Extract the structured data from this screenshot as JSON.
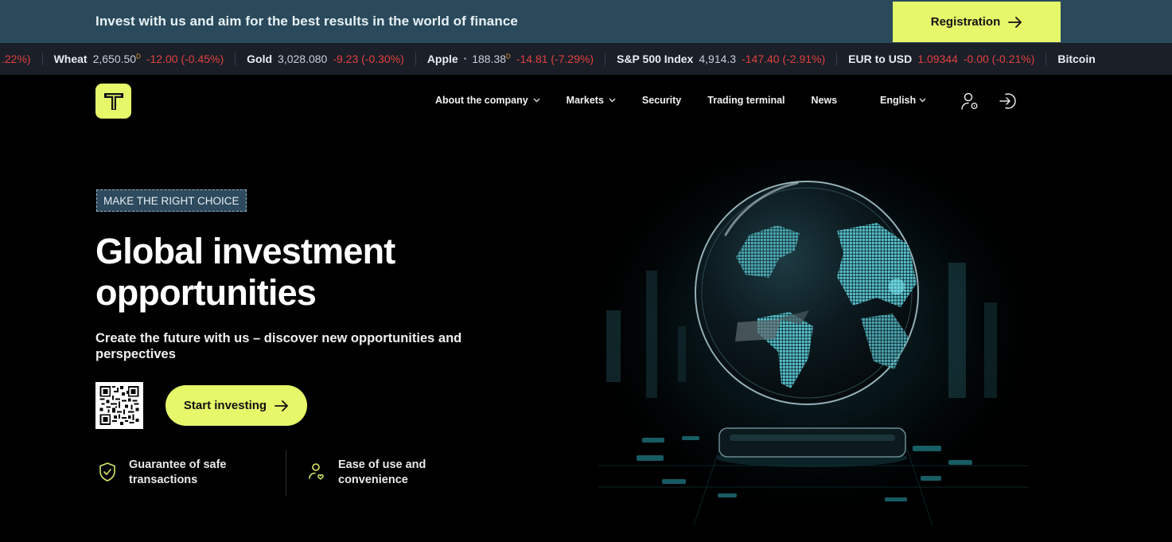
{
  "promo": {
    "text": "Invest with us and aim for the best results in the world of finance",
    "registration_label": "Registration"
  },
  "ticker": [
    {
      "name": "",
      "price": "",
      "change": ".22%)"
    },
    {
      "name": "Wheat",
      "price": "2,650.50",
      "marker": "D",
      "change": "-12.00 (-0.45%)"
    },
    {
      "name": "Gold",
      "price": "3,028.080",
      "marker": "",
      "change": "-9.23 (-0.30%)"
    },
    {
      "name": "Apple",
      "price": "188.38",
      "marker": "D",
      "change": "-14.81 (-7.29%)",
      "dot": "•"
    },
    {
      "name": "S&P 500 Index",
      "price": "4,914.3",
      "marker": "",
      "change": "-147.40 (-2.91%)"
    },
    {
      "name": "EUR to USD",
      "price": "1.09344",
      "marker": "",
      "change": "-0.00 (-0.21%)"
    },
    {
      "name": "Bitcoin",
      "price": "",
      "marker": "",
      "change": ""
    }
  ],
  "nav": {
    "items": [
      {
        "label": "About the company",
        "has_dropdown": true
      },
      {
        "label": "Markets",
        "has_dropdown": true
      },
      {
        "label": "Security",
        "has_dropdown": false
      },
      {
        "label": "Trading terminal",
        "has_dropdown": false
      },
      {
        "label": "News",
        "has_dropdown": false
      }
    ],
    "language": "English",
    "icons": [
      "user-settings-icon",
      "login-icon"
    ]
  },
  "hero": {
    "badge": "MAKE THE RIGHT CHOICE",
    "title_line1": "Global investment",
    "title_line2": "opportunities",
    "subtitle": "Create the future with us – discover new opportunities and perspectives",
    "cta_label": "Start investing"
  },
  "features": [
    {
      "icon": "shield-check-icon",
      "line1": "Guarantee of safe",
      "line2": "transactions"
    },
    {
      "icon": "user-heart-icon",
      "line1": "Ease of use and",
      "line2": "convenience"
    }
  ],
  "colors": {
    "accent": "#e6f76a",
    "promo_bg": "#2a4a5c",
    "ticker_bg": "#1a1f28",
    "negative": "#e2413e",
    "background": "#000000"
  }
}
